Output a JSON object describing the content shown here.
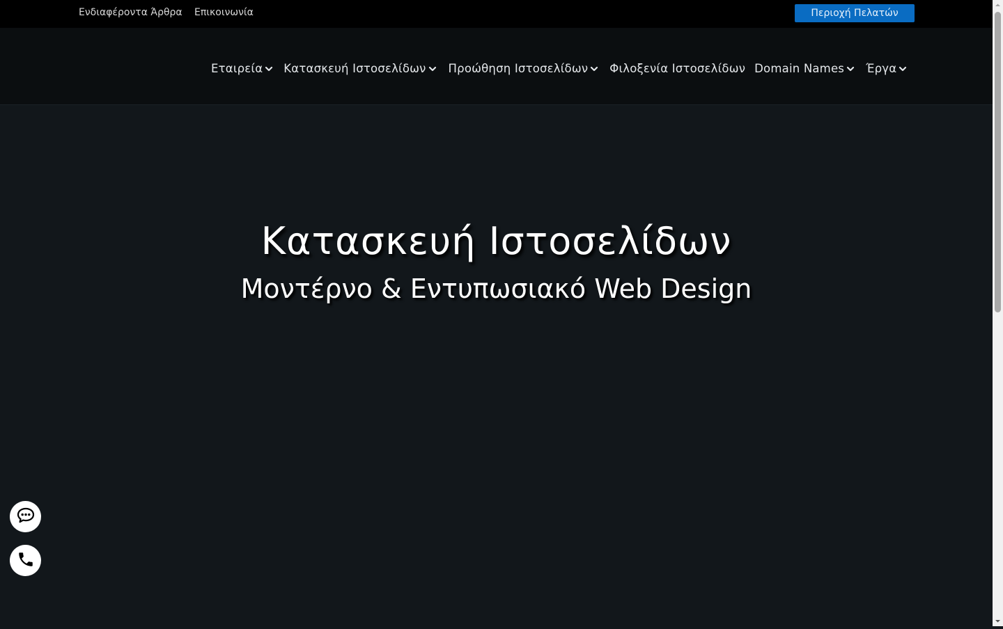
{
  "topbar": {
    "links": [
      "Ενδιαφέροντα Άρθρα",
      "Επικοινωνία"
    ],
    "client_area_label": "Περιοχή Πελατών"
  },
  "nav": {
    "items": [
      {
        "label": "Εταιρεία",
        "has_dropdown": true
      },
      {
        "label": "Κατασκευή Ιστοσελίδων",
        "has_dropdown": true
      },
      {
        "label": "Προώθηση Ιστοσελίδων",
        "has_dropdown": true
      },
      {
        "label": "Φιλοξενία Ιστοσελίδων",
        "has_dropdown": false
      },
      {
        "label": "Domain Names",
        "has_dropdown": true
      },
      {
        "label": "Έργα",
        "has_dropdown": true
      }
    ]
  },
  "hero": {
    "title": "Κατασκευή Ιστοσελίδων",
    "subtitle": "Μοντέρνο & Εντυπωσιακό Web Design"
  },
  "floating": {
    "chat_icon": "chat-bubble-icon",
    "phone_icon": "phone-icon"
  },
  "colors": {
    "topbar_bg": "#000000",
    "header_bg": "#0b0e10",
    "hero_bg": "#12171b",
    "accent": "#0a6cc2"
  }
}
